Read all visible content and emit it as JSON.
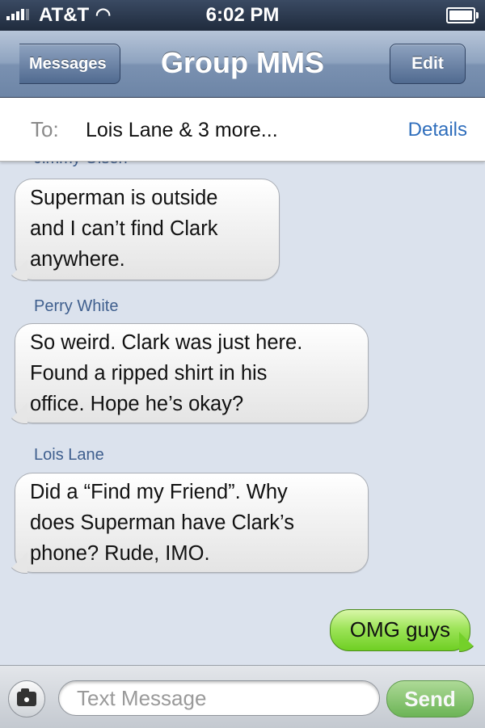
{
  "status_bar": {
    "carrier": "AT&T",
    "time": "6:02 PM"
  },
  "nav": {
    "back_label": "Messages",
    "title": "Group MMS",
    "edit_label": "Edit"
  },
  "to_field": {
    "label": "To:",
    "value": "Lois Lane & 3 more...",
    "details_label": "Details"
  },
  "messages": [
    {
      "sender": "Jimmy Olsen",
      "lines": [
        "Superman is outside",
        "and I can’t find Clark",
        "anywhere."
      ]
    },
    {
      "sender": "Perry White",
      "lines": [
        "So weird. Clark was just here.",
        "Found a ripped shirt in his",
        "office. Hope he’s okay?"
      ]
    },
    {
      "sender": "Lois Lane",
      "lines": [
        "Did a “Find my Friend”. Why",
        "does Superman have Clark’s",
        "phone? Rude, IMO."
      ]
    }
  ],
  "sent_message": "OMG guys",
  "input_bar": {
    "placeholder": "Text Message",
    "send_label": "Send"
  },
  "colors": {
    "incoming_bubble": "#f2f2f2",
    "outgoing_bubble": "#8fdd4c",
    "link": "#2f6ebc",
    "sender_name": "#3f5f8e"
  }
}
